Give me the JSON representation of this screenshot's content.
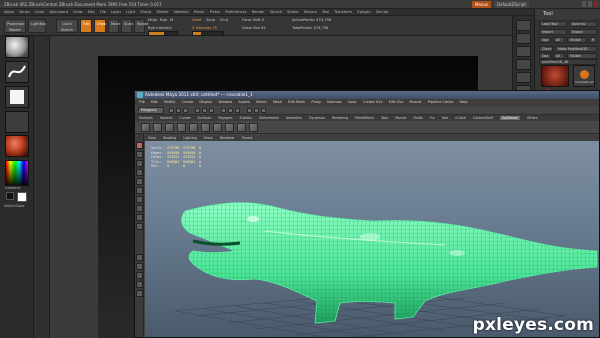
{
  "zbrush": {
    "title": "ZBrush 4R2 ZBrushCentral    ZBrush Document    Mem 7895 Free 554 Timer 0.017",
    "title_right_btns": [
      "Menus",
      "DefaultZScript"
    ],
    "menus": [
      "Alpha",
      "Brush",
      "Color",
      "Document",
      "Draw",
      "Edit",
      "File",
      "Layer",
      "Light",
      "Macro",
      "Marker",
      "Material",
      "Movie",
      "Picker",
      "Preferences",
      "Render",
      "Stencil",
      "Stroke",
      "Texture",
      "Tool",
      "Transform",
      "Zplugin",
      "Zscript"
    ],
    "shelf": {
      "projection_master": "Projection Master",
      "lightbox": "LightBox",
      "quick_sketch": "Quick Sketch",
      "edit": "Edit",
      "draw": "Draw",
      "move": "Move",
      "scale": "Scale",
      "rotate": "Rotate",
      "mrgb": "Mrgb",
      "rgb": "Rgb",
      "m": "M",
      "zadd": "Zadd",
      "zsub": "Zsub",
      "zcut": "Zcut",
      "rgb_intensity": "Rgb Intensity",
      "z_intensity": "Z Intensity 25",
      "focal_shift": "Focal Shift 0",
      "draw_size": "Draw Size 64",
      "active_points": "ActivePoints: 474,798",
      "total_points": "TotalPoints: 474,798",
      "rgb_intensity_fraction": 0.55,
      "z_intensity_fraction": 0.25
    },
    "left": {
      "gradient_label": "Gradient",
      "switch_color_label": "SwitchColor"
    },
    "tray": {
      "title": "Tool",
      "rows": [
        [
          "Load Tool",
          "Save As"
        ],
        [
          "Import",
          "Export"
        ],
        [
          "Goz",
          "All",
          "Visible",
          "R"
        ],
        [
          "Clone",
          "Make PolyMesh3D"
        ],
        [
          "Goz",
          "All",
          "Visible"
        ],
        [
          "polyMesh3D_48"
        ]
      ],
      "thumb_label": "SimpleBrush"
    }
  },
  "maya": {
    "title": "Autodesk Maya 2011 x64: untitled*   ---   crocodile1_1",
    "menus": [
      "File",
      "Edit",
      "Modify",
      "Create",
      "Display",
      "Window",
      "Assets",
      "Select",
      "Mesh",
      "Edit Mesh",
      "Proxy",
      "Normals",
      "Color",
      "Create UVs",
      "Edit UVs",
      "Muscle",
      "Pipeline Cache",
      "Help"
    ],
    "mode": "Polygons",
    "shelf_tabs": [
      "Surfaces",
      "General",
      "Curves",
      "Surfaces",
      "Polygons",
      "Subdivs",
      "Deformation",
      "Animation",
      "Dynamics",
      "Rendering",
      "PaintEffects",
      "Toon",
      "Muscle",
      "Fluids",
      "Fur",
      "Hair",
      "nCloth",
      "CustomShelf",
      "GoZBrush",
      "Others"
    ],
    "active_shelf_tab": "GoZBrush",
    "panel_menus": [
      "View",
      "Shading",
      "Lighting",
      "Show",
      "Renderer",
      "Panels"
    ],
    "hud": [
      [
        "Verts:",
        "474798",
        "474798",
        "0"
      ],
      [
        "Edges:",
        "949590",
        "949590",
        "0"
      ],
      [
        "Faces:",
        "474792",
        "474792",
        "0"
      ],
      [
        "Tris:",
        "949584",
        "949584",
        "0"
      ],
      [
        "UVs:",
        "0",
        "0",
        "0"
      ]
    ]
  },
  "watermark": "pxleyes.com",
  "colors": {
    "accent_orange": "#d97b1a",
    "mesh_green": "#5cf0a6",
    "wire_green": "#0d6e3f",
    "maya_view_top": "#7f8fa2",
    "maya_view_bottom": "#4a5a6c"
  }
}
